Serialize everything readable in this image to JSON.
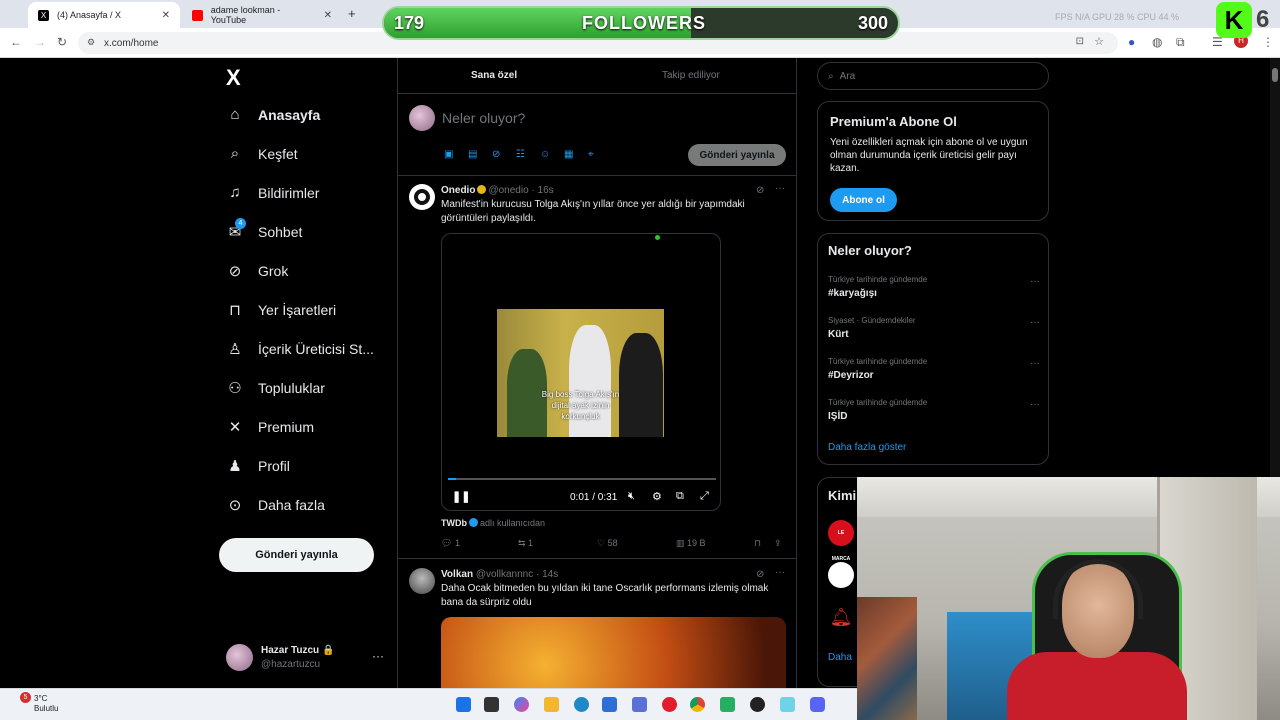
{
  "browser": {
    "tabs": [
      {
        "label": "(4) Anasayfa / X",
        "active": true
      },
      {
        "label": "adame lookman - YouTube",
        "active": false
      }
    ],
    "new_tab": "+",
    "url": "x.com/home"
  },
  "overlay": {
    "current": "179",
    "label": "FOLLOWERS",
    "goal": "300",
    "progress": 0.597,
    "fps_label": "FPS N/A   GPU 28 %   CPU 44 %",
    "badge_number": "6"
  },
  "nav": {
    "logo": "X",
    "items": [
      {
        "label": "Anasayfa",
        "icon": "home-icon"
      },
      {
        "label": "Keşfet",
        "icon": "search-icon"
      },
      {
        "label": "Bildirimler",
        "icon": "bell-icon"
      },
      {
        "label": "Sohbet",
        "icon": "mail-icon",
        "badge": "4"
      },
      {
        "label": "Grok",
        "icon": "grok-icon"
      },
      {
        "label": "Yer İşaretleri",
        "icon": "bookmark-icon"
      },
      {
        "label": "İçerik Üreticisi St...",
        "icon": "creator-icon"
      },
      {
        "label": "Topluluklar",
        "icon": "communities-icon"
      },
      {
        "label": "Premium",
        "icon": "x-icon"
      },
      {
        "label": "Profil",
        "icon": "person-icon"
      },
      {
        "label": "Daha fazla",
        "icon": "more-circle-icon"
      }
    ],
    "post_button": "Gönderi yayınla",
    "profile": {
      "name": "Hazar Tuzcu",
      "handle": "@hazartuzcu",
      "more": "···"
    }
  },
  "timeline": {
    "tabs": [
      "Sana özel",
      "Takip ediliyor"
    ],
    "compose_placeholder": "Neler oluyor?",
    "compose_post": "Gönderi yayınla",
    "tweets": [
      {
        "name": "Onedio",
        "handle": "@onedio · 16s",
        "text": "Manifest'in kurucusu Tolga Akış'ın yıllar önce yer aldığı bir yapımdaki görüntüleri paylaşıldı.",
        "video": {
          "caption_1": "Big boss Tolga Akış'ın",
          "caption_2": "dijital ayak izinin",
          "caption_3": "korkunçluk",
          "time": "0:01 / 0:31",
          "progress": 0.03
        },
        "source_name": "TWDb",
        "source_suffix": "adlı kullanıcıdan",
        "replies": "1",
        "reposts": "1",
        "likes": "58",
        "views": "19 B"
      },
      {
        "name": "Volkan",
        "handle": "@vollkannnc · 14s",
        "text": "Daha Ocak bitmeden bu yıldan iki tane Oscarlık performans izlemiş olmak bana da sürpriz oldu"
      }
    ]
  },
  "sidebar": {
    "search_placeholder": "Ara",
    "premium": {
      "title": "Premium'a Abone Ol",
      "text": "Yeni özellikleri açmak için abone ol ve uygun olman durumunda içerik üreticisi gelir payı kazan.",
      "button": "Abone ol"
    },
    "trends": {
      "title": "Neler oluyor?",
      "items": [
        {
          "context": "Türkiye tarihinde gündemde",
          "topic": "#karyağışı"
        },
        {
          "context": "Siyaset · Gündemdekiler",
          "topic": "Kürt"
        },
        {
          "context": "Türkiye tarihinde gündemde",
          "topic": "#Deyrizor"
        },
        {
          "context": "Türkiye tarihinde gündemde",
          "topic": "IŞİD"
        }
      ],
      "show_more": "Daha fazla göster"
    },
    "who_to_follow_partial": "Kimi",
    "who_to_follow_more_partial": "Daha",
    "marca": "LE MARCA"
  },
  "taskbar": {
    "temp": "3°C",
    "weather": "Bulutlu",
    "weather_badge": "5"
  },
  "colors": {
    "accent": "#1d9bf0",
    "bg": "#000000",
    "border": "#2f3336",
    "muted": "#71767b",
    "followers_fill": "#3fbf3f"
  }
}
